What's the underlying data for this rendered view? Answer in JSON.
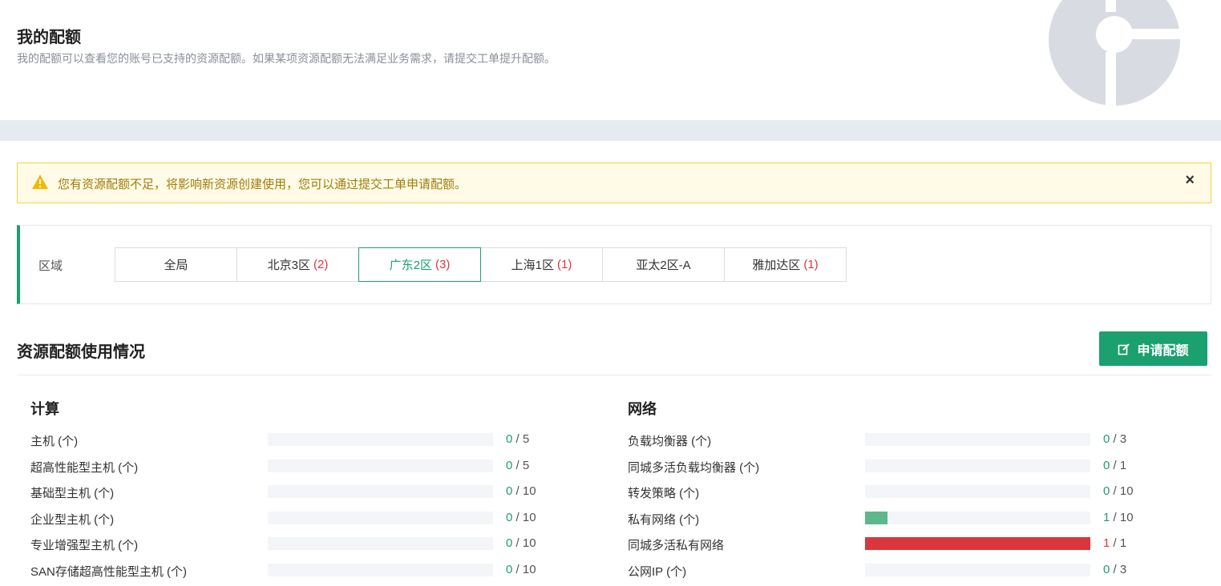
{
  "header": {
    "title": "我的配额",
    "description": "我的配额可以查看您的账号已支持的资源配额。如果某项资源配额无法满足业务需求，请提交工单提升配额。"
  },
  "alert": {
    "icon": "warning-icon",
    "text": "您有资源配额不足，将影响新资源创建使用，您可以通过提交工单申请配额。",
    "close": "×"
  },
  "region": {
    "label": "区域",
    "tabs": [
      {
        "name": "全局",
        "count": ""
      },
      {
        "name": "北京3区",
        "count": "(2)"
      },
      {
        "name": "广东2区",
        "count": "(3)"
      },
      {
        "name": "上海1区",
        "count": "(1)"
      },
      {
        "name": "亚太2区-A",
        "count": ""
      },
      {
        "name": "雅加达区",
        "count": "(1)"
      }
    ],
    "active_index": 2
  },
  "usage": {
    "title": "资源配额使用情况",
    "apply_button": "申请配额",
    "colors": {
      "ok": "#1ba070",
      "bar_partial": "#5cb88a",
      "full": "#d9363e"
    }
  },
  "compute": {
    "title": "计算",
    "items": [
      {
        "label": "主机 (个)",
        "used": "0",
        "total": "/ 5",
        "ratio": 0
      },
      {
        "label": "超高性能型主机 (个)",
        "used": "0",
        "total": "/ 5",
        "ratio": 0
      },
      {
        "label": "基础型主机 (个)",
        "used": "0",
        "total": "/ 10",
        "ratio": 0
      },
      {
        "label": "企业型主机 (个)",
        "used": "0",
        "total": "/ 10",
        "ratio": 0
      },
      {
        "label": "专业增强型主机 (个)",
        "used": "0",
        "total": "/ 10",
        "ratio": 0
      },
      {
        "label": "SAN存储超高性能型主机 (个)",
        "used": "0",
        "total": "/ 10",
        "ratio": 0
      }
    ]
  },
  "network": {
    "title": "网络",
    "items": [
      {
        "label": "负载均衡器 (个)",
        "used": "0",
        "total": "/ 3",
        "ratio": 0
      },
      {
        "label": "同城多活负载均衡器 (个)",
        "used": "0",
        "total": "/ 1",
        "ratio": 0
      },
      {
        "label": "转发策略 (个)",
        "used": "0",
        "total": "/ 10",
        "ratio": 0
      },
      {
        "label": "私有网络 (个)",
        "used": "1",
        "total": "/ 10",
        "ratio": 0.1
      },
      {
        "label": "同城多活私有网络",
        "used": "1",
        "total": "/ 1",
        "ratio": 1
      },
      {
        "label": "公网IP (个)",
        "used": "0",
        "total": "/ 3",
        "ratio": 0
      }
    ]
  }
}
